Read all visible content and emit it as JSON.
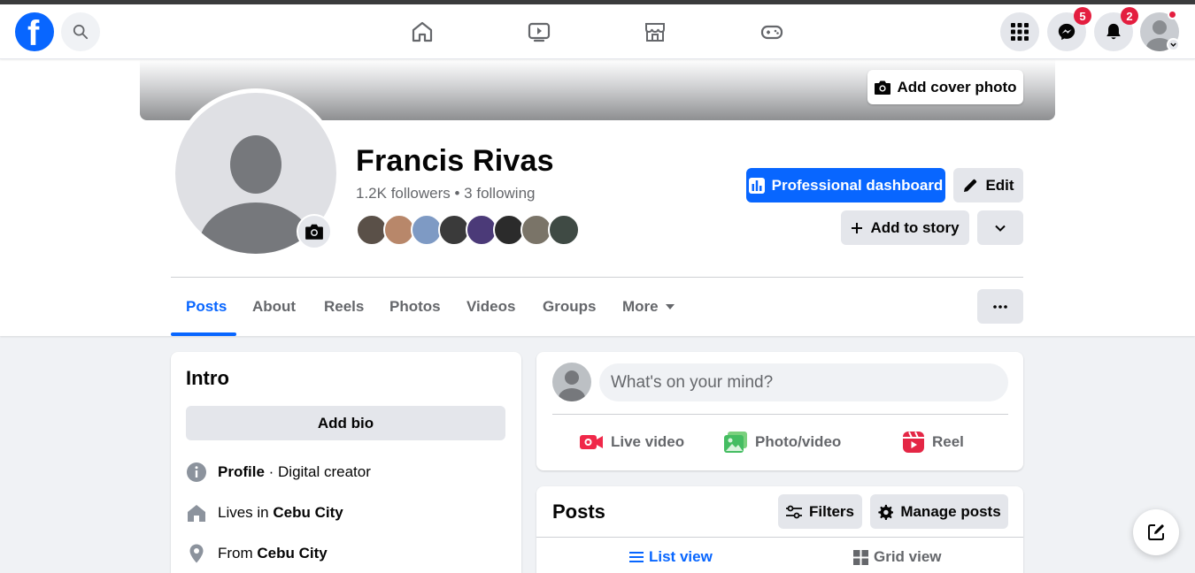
{
  "topbar": {
    "logo_letter": "f",
    "messenger_badge": "5",
    "notifications_badge": "2",
    "nav_icons": [
      "home-icon",
      "watch-icon",
      "marketplace-icon",
      "gaming-icon"
    ],
    "accent_color": "#0866ff"
  },
  "cover": {
    "add_cover_label": "Add cover photo"
  },
  "profile": {
    "name": "Francis Rivas",
    "followers_text": "1.2K followers • 3 following",
    "friend_avatar_colors": [
      "#5a5048",
      "#b8876a",
      "#7e9ac4",
      "#3a3a3a",
      "#4b3a78",
      "#2b2b2b",
      "#7a7468",
      "#3f4a44"
    ]
  },
  "actions": {
    "professional_dashboard": "Professional dashboard",
    "edit": "Edit",
    "add_to_story": "Add to story"
  },
  "tabs": [
    {
      "label": "Posts",
      "active": true
    },
    {
      "label": "About",
      "active": false
    },
    {
      "label": "Reels",
      "active": false
    },
    {
      "label": "Photos",
      "active": false
    },
    {
      "label": "Videos",
      "active": false
    },
    {
      "label": "Groups",
      "active": false
    },
    {
      "label": "More",
      "active": false
    }
  ],
  "intro": {
    "title": "Intro",
    "add_bio": "Add bio",
    "rows": [
      {
        "bold": "Profile",
        "text": " · Digital creator"
      },
      {
        "prefix": "Lives in ",
        "bold": "Cebu City"
      },
      {
        "prefix": "From ",
        "bold": "Cebu City"
      }
    ]
  },
  "composer": {
    "placeholder": "What's on your mind?",
    "live_video": "Live video",
    "photo_video": "Photo/video",
    "reel": "Reel"
  },
  "posts": {
    "title": "Posts",
    "filters": "Filters",
    "manage_posts": "Manage posts",
    "list_view": "List view",
    "grid_view": "Grid view"
  }
}
